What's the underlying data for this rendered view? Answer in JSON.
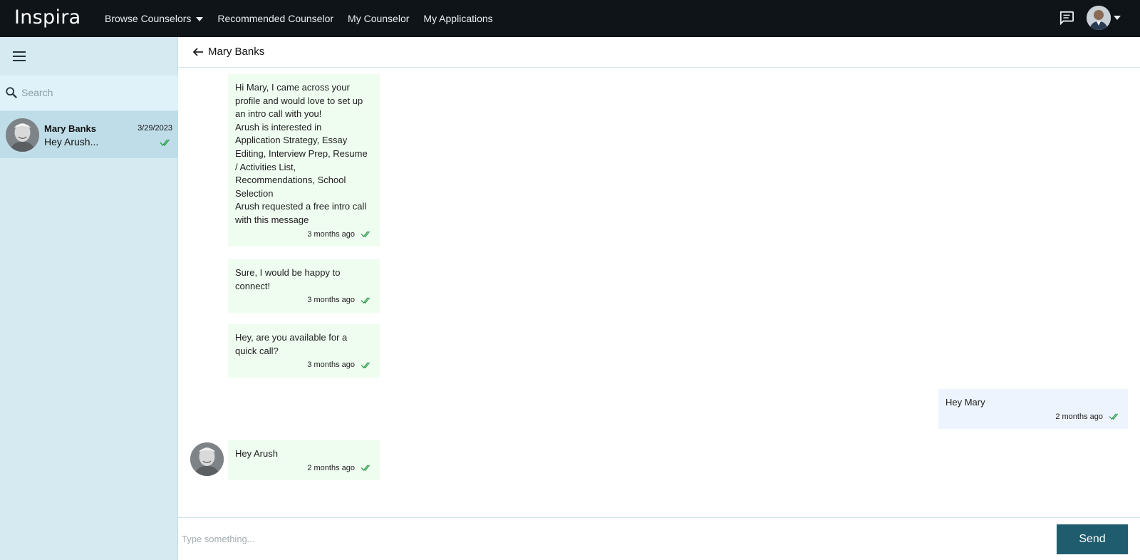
{
  "app": {
    "logo": "Inspira"
  },
  "nav": {
    "browse": "Browse Counselors",
    "recommended": "Recommended Counselor",
    "my_counselor": "My Counselor",
    "my_applications": "My Applications"
  },
  "sidebar": {
    "search_placeholder": "Search",
    "conversations": [
      {
        "name": "Mary Banks",
        "date": "3/29/2023",
        "preview": "Hey Arush..."
      }
    ]
  },
  "chat": {
    "title": "Mary Banks",
    "messages": [
      {
        "text": "Hi Mary, I came across your\nprofile and would love to set up\nan intro call with you!\nArush is interested in\nApplication Strategy, Essay\nEditing, Interview Prep, Resume\n/ Activities List,\nRecommendations, School\nSelection\nArush requested a free intro call\nwith this message",
        "time": "3 months ago"
      },
      {
        "text": "Sure, I would be happy to\nconnect!",
        "time": "3 months ago"
      },
      {
        "text": "Hey, are you available for a\nquick call?",
        "time": "3 months ago"
      },
      {
        "text": "Hey Mary",
        "time": "2 months ago"
      },
      {
        "text": "Hey Arush",
        "time": "2 months ago"
      }
    ],
    "composer_placeholder": "Type something...",
    "send_label": "Send"
  },
  "colors": {
    "topbar": "#0f1418",
    "sidebar": "#d6eaf2",
    "incoming_bubble": "#effdf0",
    "outgoing_bubble": "#eef4fd",
    "send_button": "#1f5d6e",
    "read_check": "#2e9e4f"
  },
  "icons": {
    "nav_chat": "chat-bubble-icon",
    "menu": "hamburger-icon",
    "search": "search-icon",
    "back": "arrow-left-icon",
    "read": "double-check-icon"
  }
}
